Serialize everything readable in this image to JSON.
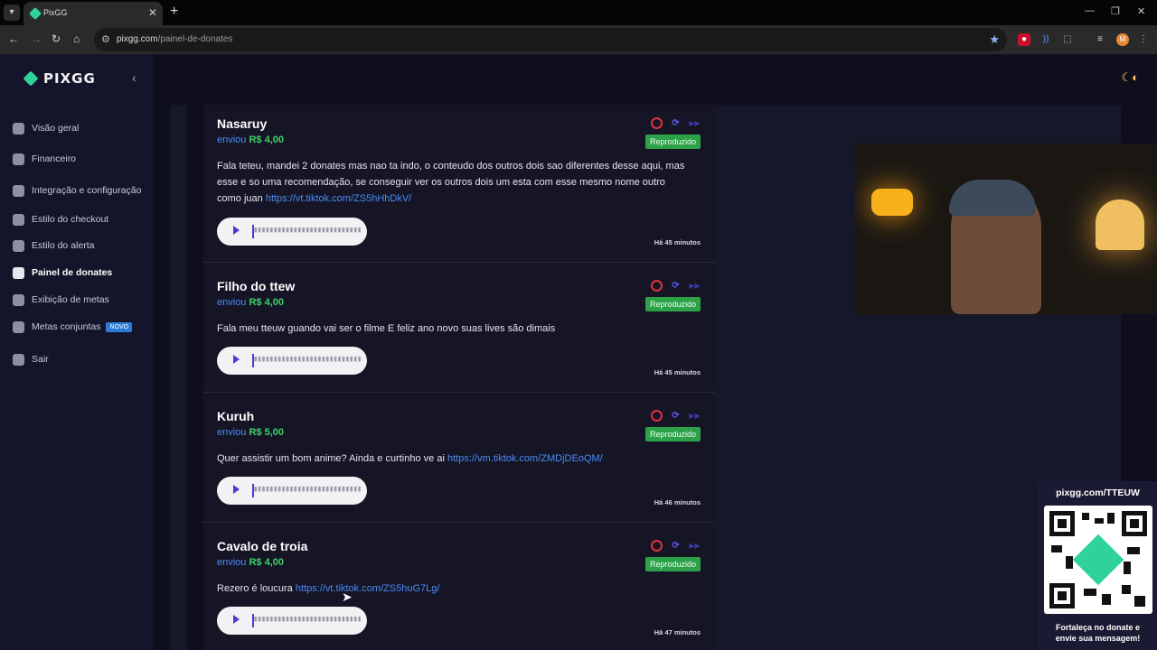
{
  "browser": {
    "tab_title": "PixGG",
    "url_domain": "pixgg.com",
    "url_path": "/painel-de-donates"
  },
  "sidebar": {
    "logo": "PIXGG",
    "items": [
      {
        "label": "Visão geral"
      },
      {
        "label": "Financeiro"
      },
      {
        "label": "Integração e configuração"
      },
      {
        "label": "Estilo do checkout"
      },
      {
        "label": "Estilo do alerta"
      },
      {
        "label": "Painel de donates"
      },
      {
        "label": "Exibição de metas"
      },
      {
        "label": "Metas conjuntas",
        "badge": "NOVO"
      },
      {
        "label": "Sair"
      }
    ]
  },
  "donations": [
    {
      "name": "Nasaruy",
      "sent": "enviou",
      "amount": "R$ 4,00",
      "message": "Fala teteu, mandei 2 donates mas nao ta indo, o conteudo dos outros dois sao diferentes desse aqui, mas esse e so uma recomendação, se conseguir ver os outros dois um esta com esse mesmo nome outro como juan",
      "link": "https://vt.tiktok.com/ZS5hHhDkV/",
      "status": "Reproduzido",
      "time": "Há 45 minutos"
    },
    {
      "name": "Filho do ttew",
      "sent": "enviou",
      "amount": "R$ 4,00",
      "message": "Fala meu tteuw guando vai ser o filme E feliz ano novo suas lives são dimais",
      "link": "",
      "status": "Reproduzido",
      "time": "Há 45 minutos"
    },
    {
      "name": "Kuruh",
      "sent": "enviou",
      "amount": "R$ 5,00",
      "message": "Quer assistir um bom anime? Ainda e curtinho ve ai",
      "link": "https://vm.tiktok.com/ZMDjDEoQM/",
      "status": "Reproduzido",
      "time": "Há 46 minutos"
    },
    {
      "name": "Cavalo de troia",
      "sent": "enviou",
      "amount": "R$ 4,00",
      "message": "Rezero é loucura",
      "link": "https://vt.tiktok.com/ZS5huG7Lg/",
      "status": "Reproduzido",
      "time": "Há 47 minutos"
    }
  ],
  "qr_widget": {
    "title": "pixgg.com/TTEUW",
    "caption_line1": "Fortaleça no donate e",
    "caption_line2": "envie sua mensagem!"
  }
}
